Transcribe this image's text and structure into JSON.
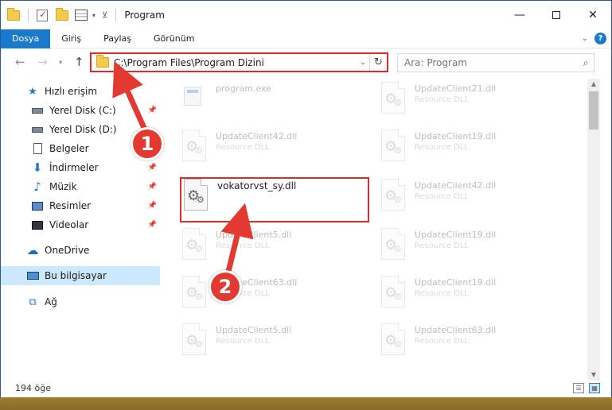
{
  "window": {
    "title": "Program"
  },
  "ribbon": {
    "tabs": [
      "Dosya",
      "Giriş",
      "Paylaş",
      "Görünüm"
    ]
  },
  "address": {
    "path": "C:\\Program Files\\Program Dizini"
  },
  "search": {
    "placeholder": "Ara: Program"
  },
  "sidebar": {
    "items": [
      {
        "label": "Hızlı erişim",
        "icon": "star-icon"
      },
      {
        "label": "Yerel Disk (C:)",
        "icon": "drive-icon"
      },
      {
        "label": "Yerel Disk (D:)",
        "icon": "drive-icon"
      },
      {
        "label": "Belgeler",
        "icon": "documents-icon"
      },
      {
        "label": "İndirmeler",
        "icon": "download-icon"
      },
      {
        "label": "Müzik",
        "icon": "music-icon"
      },
      {
        "label": "Resimler",
        "icon": "pictures-icon"
      },
      {
        "label": "Videolar",
        "icon": "video-icon"
      },
      {
        "label": "OneDrive",
        "icon": "cloud-icon"
      },
      {
        "label": "Bu bilgisayar",
        "icon": "computer-icon"
      },
      {
        "label": "Ağ",
        "icon": "network-icon"
      }
    ]
  },
  "files": {
    "items": [
      {
        "name": "program.exe",
        "type": ""
      },
      {
        "name": "UpdateClient21.dll",
        "type": "Resource DLL"
      },
      {
        "name": "UpdateClient42.dll",
        "type": "Resource DLL"
      },
      {
        "name": "UpdateClient19.dll",
        "type": "Resource DLL"
      },
      {
        "name": "vokatorvst_sy.dll",
        "type": ""
      },
      {
        "name": "UpdateClient42.dll",
        "type": "Resource DLL"
      },
      {
        "name": "UpdateClient5.dll",
        "type": "Resource DLL"
      },
      {
        "name": "UpdateClient19.dll",
        "type": "Resource DLL"
      },
      {
        "name": "UpdateClient63.dll",
        "type": "Resource DLL"
      },
      {
        "name": "UpdateClient19.dll",
        "type": "Resource DLL"
      },
      {
        "name": "UpdateClient5.dll",
        "type": "Resource DLL"
      },
      {
        "name": "UpdateClient63.dll",
        "type": "Resource DLL"
      }
    ]
  },
  "status": {
    "count": "194 öğe"
  },
  "annotations": {
    "badge1": "1",
    "badge2": "2",
    "highlight_color": "#e02a2a",
    "badge_color": "#e23a31"
  }
}
